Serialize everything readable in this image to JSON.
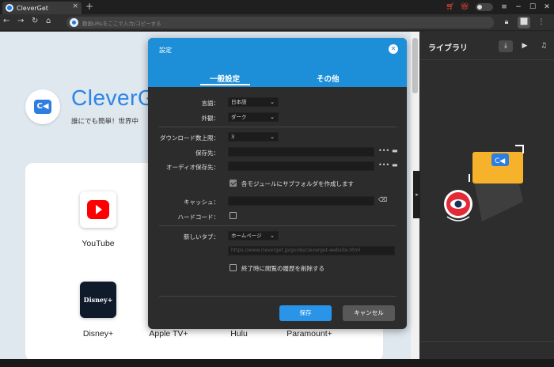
{
  "window": {
    "tab_title": "CleverGet",
    "new_tab_glyph": "+",
    "titlebar_icons": [
      "cart-icon",
      "gift-icon",
      "theme-toggle-icon",
      "menu-icon",
      "minimize-icon",
      "maximize-icon",
      "close-icon"
    ]
  },
  "addressbar": {
    "placeholder": "動画URLをここで入力/コピーする"
  },
  "hero": {
    "brand_partial": "CleverG",
    "subtitle_partial": "誰にでも簡単！世界中"
  },
  "sites": [
    {
      "label": "YouTube"
    },
    {
      "label": "Disney+"
    },
    {
      "label": "Apple TV+"
    },
    {
      "label": "Hulu"
    },
    {
      "label": "Paramount+"
    }
  ],
  "library": {
    "title": "ライブラリ"
  },
  "settings": {
    "title": "設定",
    "tabs": [
      "一般設定",
      "その他"
    ],
    "language_label": "言語：",
    "language_value": "日本語",
    "appearance_label": "外観：",
    "appearance_value": "ダーク",
    "download_limit_label": "ダウンロード数上限：",
    "download_limit_value": "3",
    "save_to_label": "保存先：",
    "save_to_value": "",
    "audio_save_to_label": "オーディオ保存先：",
    "audio_save_to_value": "",
    "subfolder_label": "各モジュールにサブフォルダを作成します",
    "subfolder_checked": true,
    "cache_label": "キャッシュ：",
    "hardcode_label": "ハードコード：",
    "hardcode_checked": false,
    "new_tab_label": "新しいタブ：",
    "new_tab_value": "ホームページ",
    "homepage_url": "https://www.cleverget.jp/guide/cleverget-website.html",
    "clear_history_label": "終了時に閲覧の履歴を削除する",
    "clear_history_checked": false,
    "save_button": "保存",
    "cancel_button": "キャンセル"
  }
}
